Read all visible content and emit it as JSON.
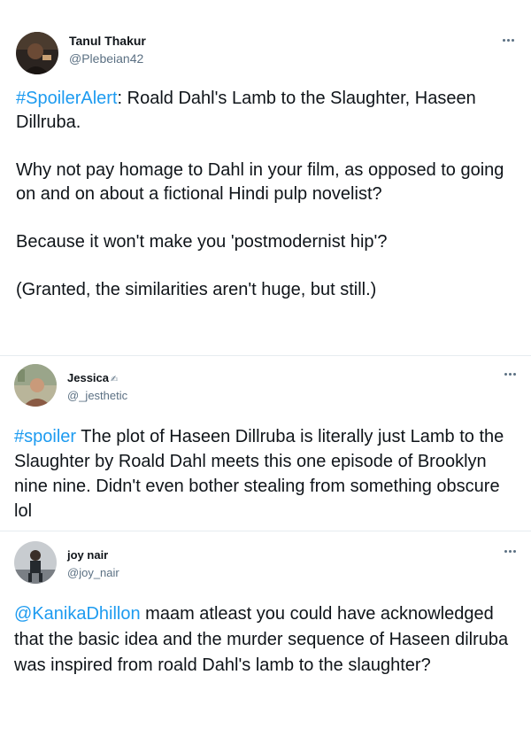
{
  "tweets": [
    {
      "author": {
        "name": "Tanul Thakur",
        "handle": "@Plebeian42"
      },
      "hashtag": "#SpoilerAlert",
      "paragraphs": [
        ": Roald Dahl's Lamb to the Slaughter, Haseen Dillruba.",
        "Why not pay homage to Dahl in your film, as opposed to going on and on about a fictional Hindi pulp novelist?",
        "Because it won't make you 'postmodernist hip'?",
        "(Granted, the similarities aren't huge, but still.)"
      ]
    },
    {
      "author": {
        "name": "Jessica",
        "badge": "✍︎",
        "handle": "@_jesthetic"
      },
      "hashtag": "#spoiler",
      "paragraphs": [
        " The plot of Haseen Dillruba is literally just Lamb to the Slaughter by Roald Dahl meets this one episode of Brooklyn nine nine. Didn't even bother stealing from something obscure lol"
      ]
    },
    {
      "author": {
        "name": "joy nair",
        "handle": "@joy_nair"
      },
      "hashtag": "@KanikaDhillon",
      "paragraphs": [
        " maam atleast you could have acknowledged that the basic idea and the murder sequence of Haseen dilruba was inspired from roald Dahl's lamb to the slaughter?"
      ]
    }
  ],
  "colors": {
    "link": "#1d9bf0",
    "text": "#0f1419",
    "muted": "#5b7083"
  },
  "icons": {
    "more": "more-horizontal-icon"
  }
}
